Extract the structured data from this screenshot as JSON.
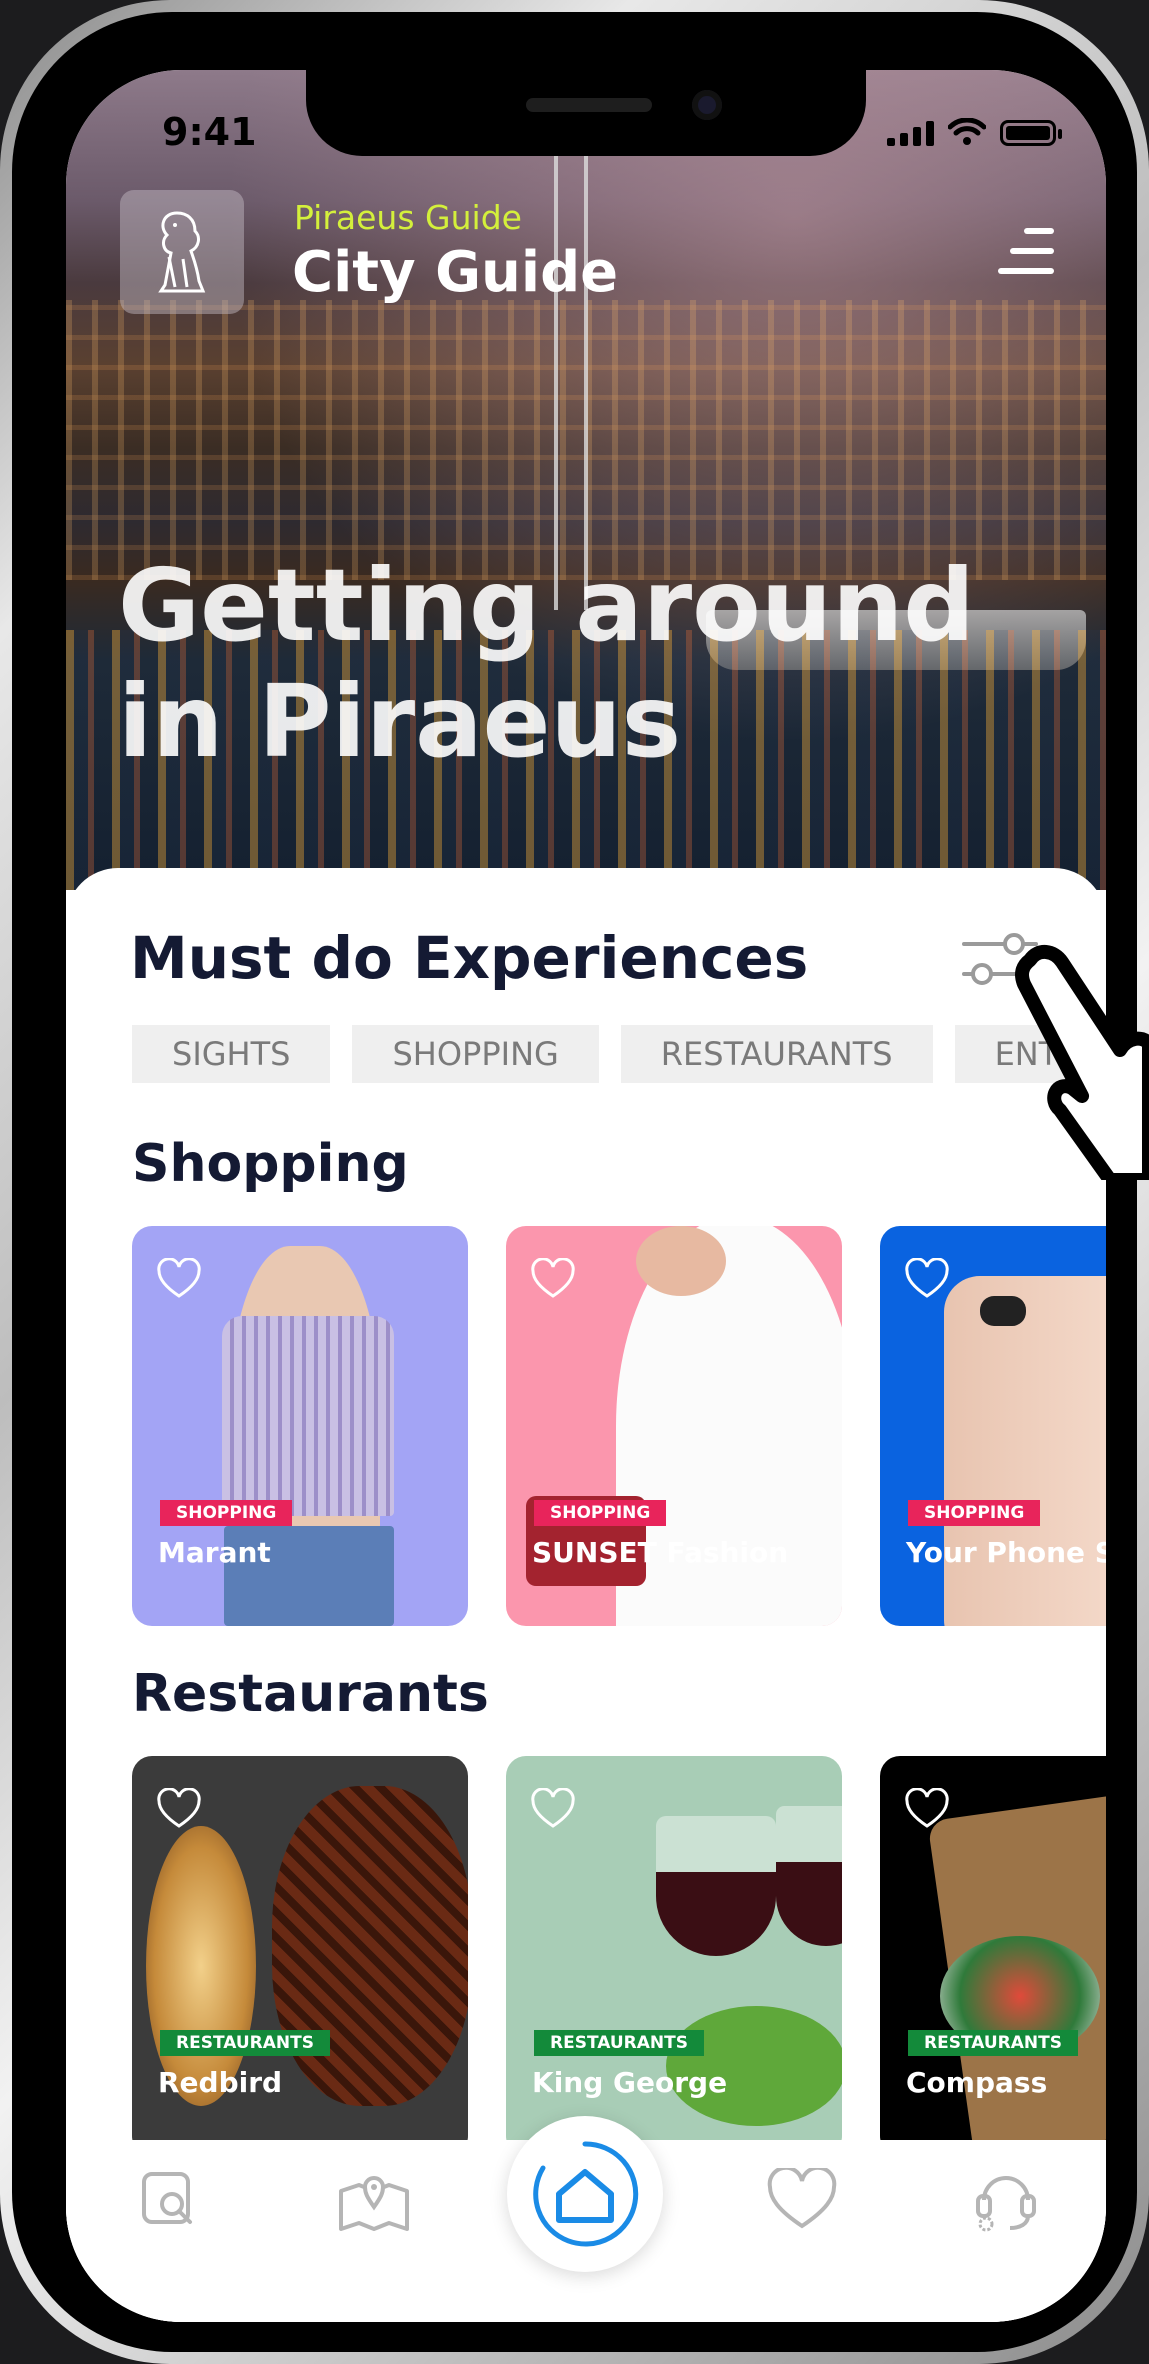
{
  "status_bar": {
    "time": "9:41"
  },
  "header": {
    "subtitle": "Piraeus Guide",
    "title": "City Guide",
    "hero_heading_line1": "Getting around",
    "hero_heading_line2": "in Piraeus"
  },
  "experiences": {
    "heading": "Must do Experiences",
    "chips": [
      "SIGHTS",
      "SHOPPING",
      "RESTAURANTS",
      "ENTE"
    ]
  },
  "shopping": {
    "heading": "Shopping",
    "cards": [
      {
        "category": "SHOPPING",
        "name": "Marant",
        "bg": "#a3a4f5"
      },
      {
        "category": "SHOPPING",
        "name": "SUNSET Fashion",
        "bg": "#fb96ad"
      },
      {
        "category": "SHOPPING",
        "name": "Your Phone Sho",
        "bg": "#0a63e0"
      }
    ]
  },
  "restaurants": {
    "heading": "Restaurants",
    "cards": [
      {
        "category": "RESTAURANTS",
        "name": "Redbird",
        "bg": "#3b3b3b"
      },
      {
        "category": "RESTAURANTS",
        "name": "King George",
        "bg": "#a8cdb6"
      },
      {
        "category": "RESTAURANTS",
        "name": "Compass",
        "bg": "#000000"
      }
    ]
  },
  "bottom_nav": [
    "search-icon",
    "map-icon",
    "home-icon",
    "heart-icon",
    "support-icon"
  ],
  "colors": {
    "accent": "#d4f03b",
    "primary_blue": "#1a8be6",
    "heading": "#141a33"
  }
}
